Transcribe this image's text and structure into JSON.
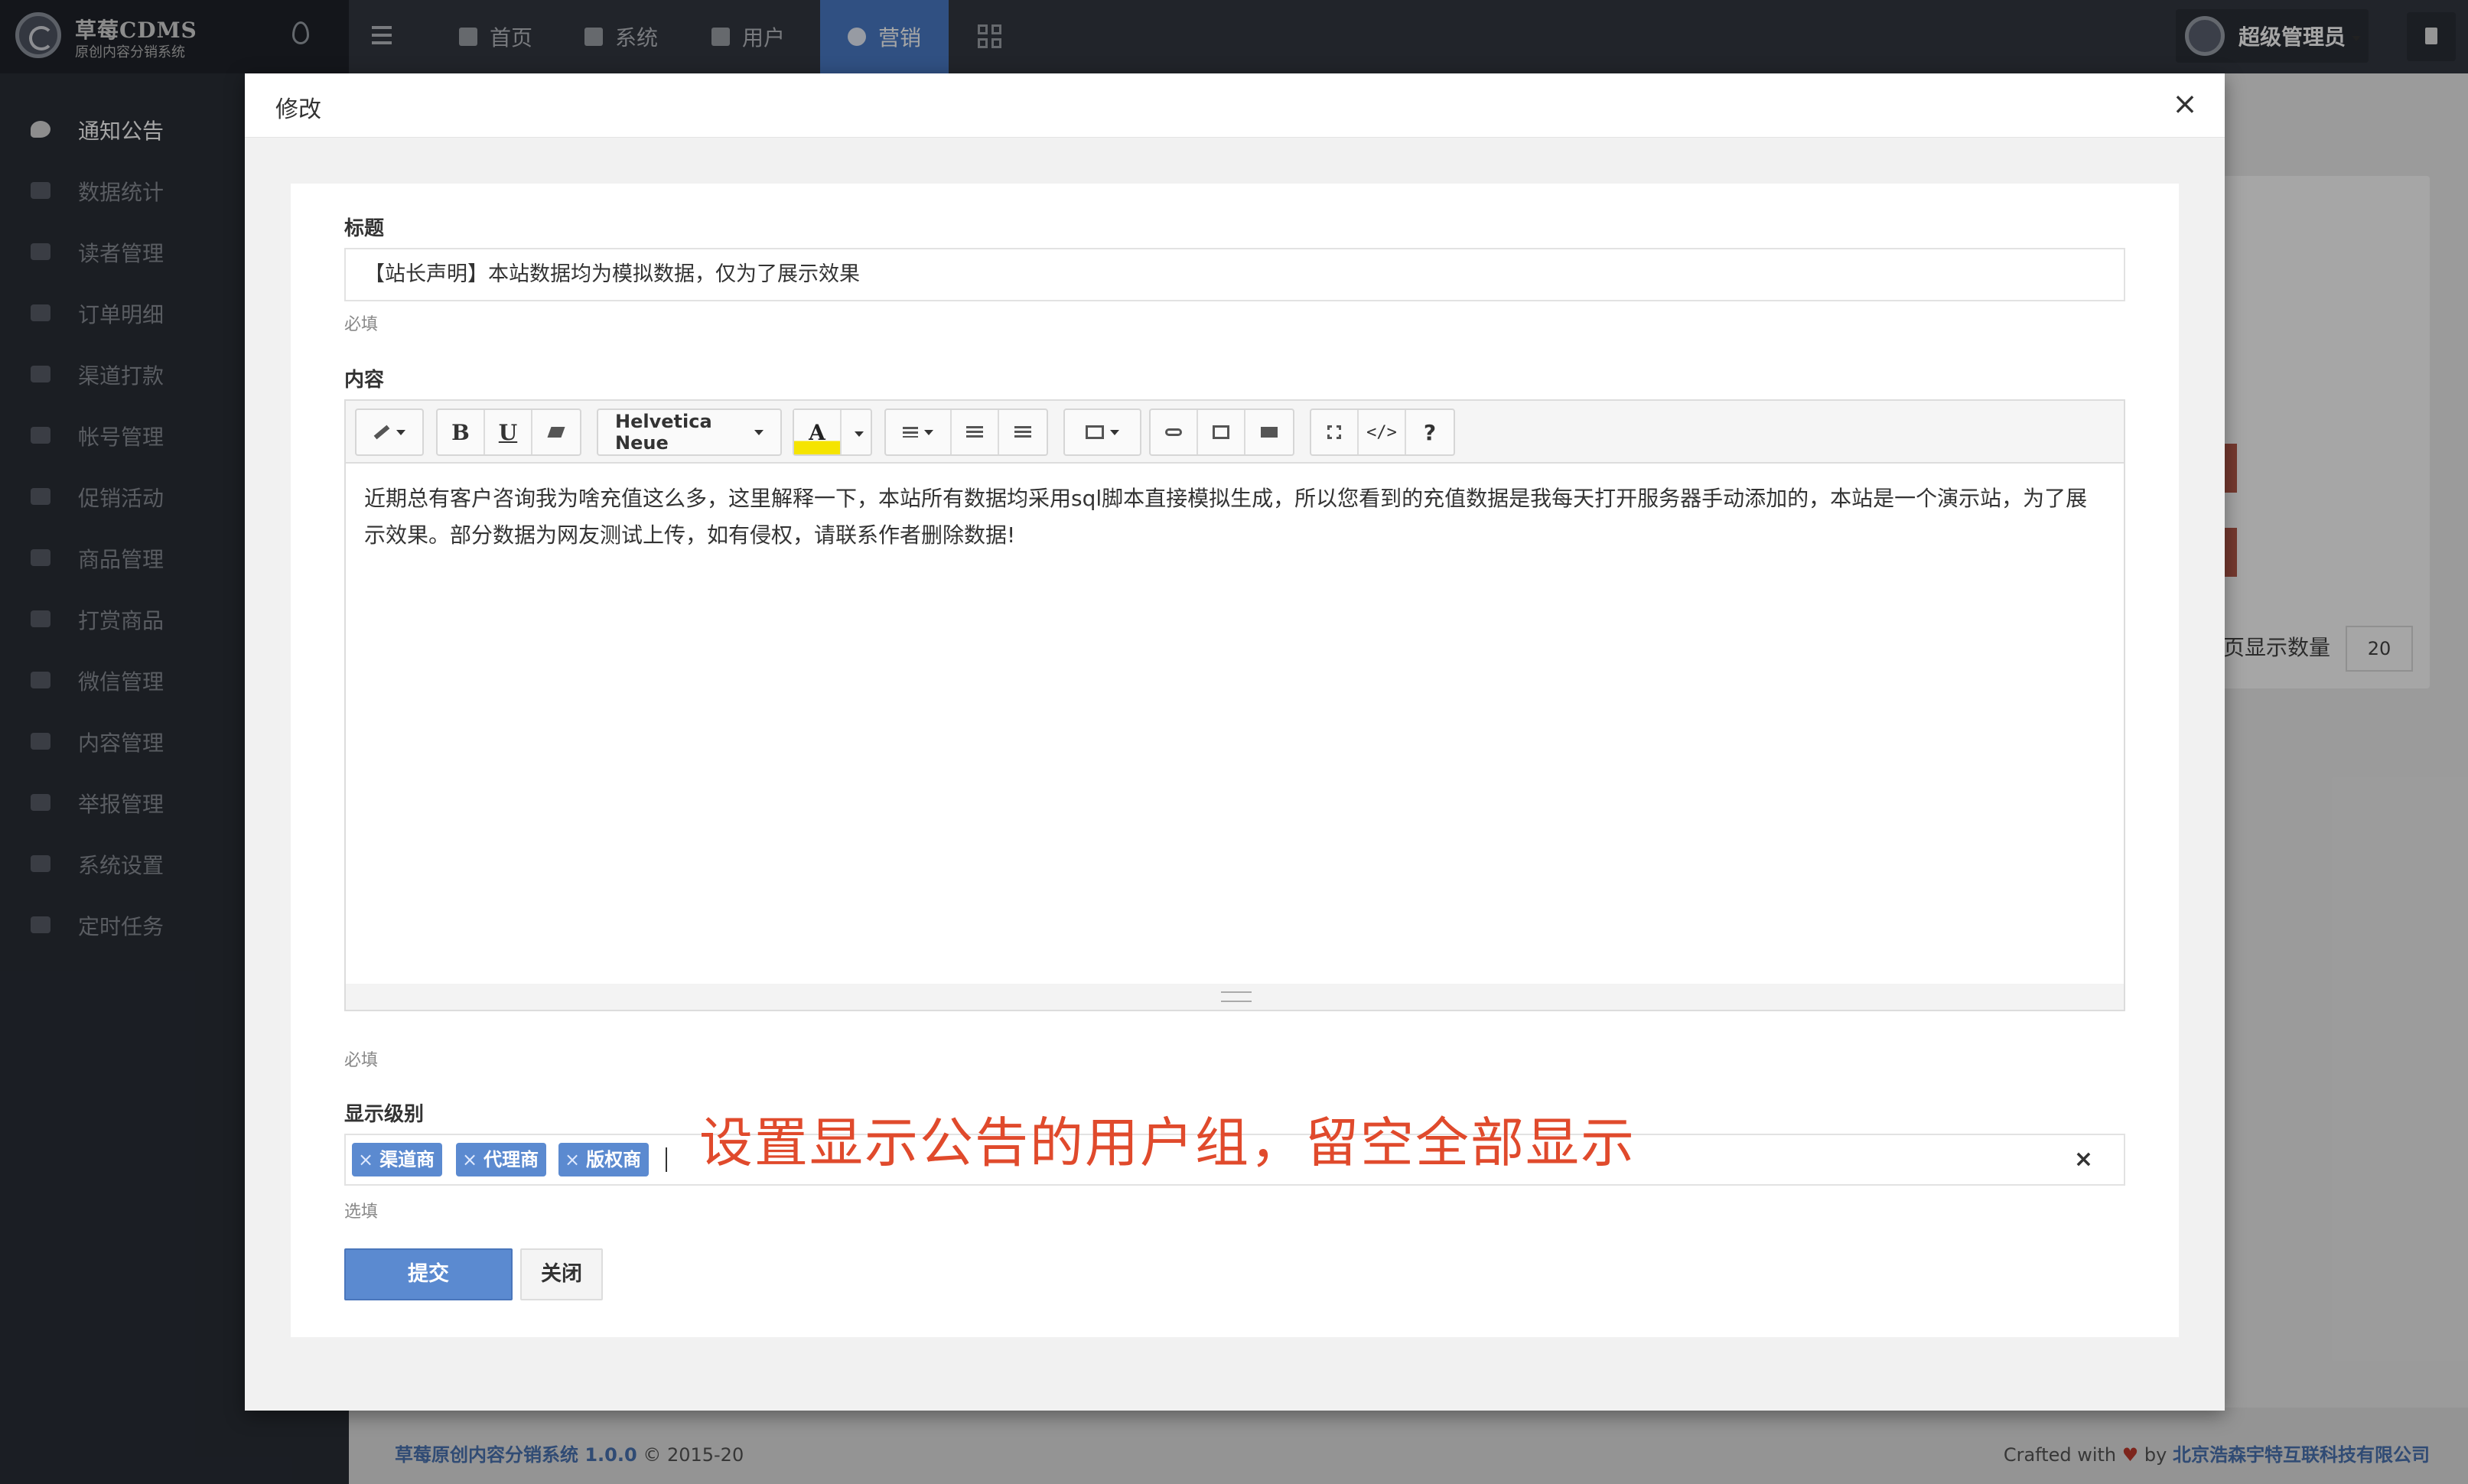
{
  "brand": {
    "name": "草莓CDMS",
    "subtitle": "原创内容分销系统"
  },
  "sidebar": {
    "items": [
      {
        "label": "通知公告",
        "icon": "comment-icon",
        "active": true
      },
      {
        "label": "数据统计",
        "icon": "bar-chart-icon"
      },
      {
        "label": "读者管理",
        "icon": "lock-icon"
      },
      {
        "label": "订单明细",
        "icon": "cart-icon"
      },
      {
        "label": "渠道打款",
        "icon": "credit-card-icon"
      },
      {
        "label": "帐号管理",
        "icon": "user-gear-icon"
      },
      {
        "label": "促销活动",
        "icon": "briefcase-icon"
      },
      {
        "label": "商品管理",
        "icon": "diamond-icon"
      },
      {
        "label": "打赏商品",
        "icon": "heart-icon"
      },
      {
        "label": "微信管理",
        "icon": "wechat-icon"
      },
      {
        "label": "内容管理",
        "icon": "book-icon"
      },
      {
        "label": "举报管理",
        "icon": "frown-icon"
      },
      {
        "label": "系统设置",
        "icon": "gear-icon"
      },
      {
        "label": "定时任务",
        "icon": "clock-icon"
      }
    ]
  },
  "topnav": {
    "items": [
      {
        "label": "首页",
        "icon": "home-icon"
      },
      {
        "label": "系统",
        "icon": "gear-icon"
      },
      {
        "label": "用户",
        "icon": "user-icon"
      },
      {
        "label": "营销",
        "icon": "cloud-icon",
        "active": true
      }
    ],
    "admin_label": "超级管理员"
  },
  "background": {
    "page_size_label": "页显示数量",
    "page_size_value": "20"
  },
  "modal": {
    "title": "修改",
    "close_glyph": "×",
    "title_label": "标题",
    "title_value": "【站长声明】本站数据均为模拟数据，仅为了展示效果",
    "title_help": "必填",
    "content_label": "内容",
    "content_text": "近期总有客户咨询我为啥充值这么多，这里解释一下，本站所有数据均采用sql脚本直接模拟生成，所以您看到的充值数据是我每天打开服务器手动添加的，本站是一个演示站，为了展示效果。部分数据为网友测试上传，如有侵权，请联系作者删除数据!",
    "content_help": "必填",
    "toolbar": {
      "font_name": "Helvetica Neue",
      "bold": "B",
      "underline": "U",
      "color": "A",
      "help": "?",
      "code": "</>"
    },
    "level_label": "显示级别",
    "tags": [
      "渠道商",
      "代理商",
      "版权商"
    ],
    "tag_remove": "×",
    "level_help": "选填",
    "clear_glyph": "×",
    "annotation": "设置显示公告的用户组，留空全部显示",
    "submit_label": "提交",
    "close_label": "关闭"
  },
  "footer": {
    "left_name": "草莓原创内容分销系统 1.0.0",
    "left_rest": " © 2015-20",
    "crafted": "Crafted with ",
    "heart": "♥",
    "by": " by ",
    "company": "北京浩森宇特互联科技有限公司"
  },
  "colors": {
    "sidebar": "#2a2e37",
    "topbar": "#343841",
    "accent": "#4a7cc8",
    "tag": "#5b8ad0",
    "annotation": "#e04a2c"
  }
}
